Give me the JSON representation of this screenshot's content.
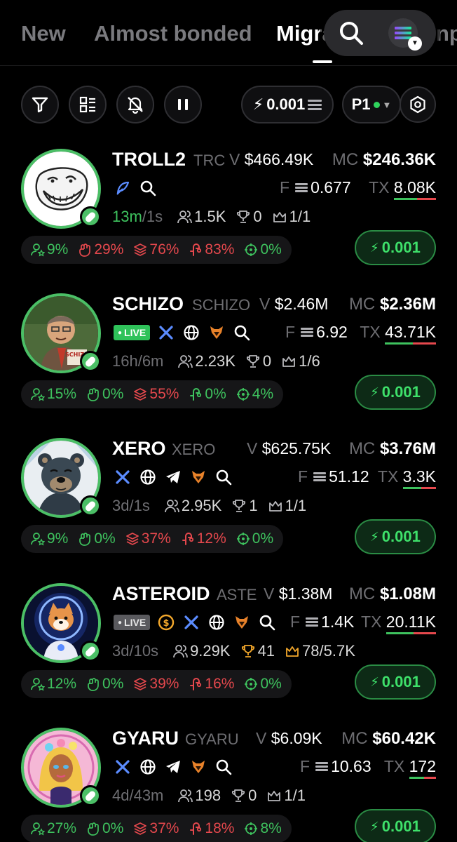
{
  "tabs": [
    {
      "label": "New",
      "active": false
    },
    {
      "label": "Almost bonded",
      "active": false
    },
    {
      "label": "Migra",
      "active": true
    },
    {
      "label": "np",
      "active": false
    }
  ],
  "toolbar": {
    "quick_buy_amount": "0.001",
    "preset_label": "P1"
  },
  "colors": {
    "accent_green": "#3ec25e",
    "danger_red": "#e5484d",
    "muted": "#6e6e72"
  },
  "tokens": [
    {
      "name": "TROLL2",
      "ticker": "TRC",
      "volume_label": "V",
      "volume": "$466.49K",
      "mc_label": "MC",
      "market_cap": "$246.36K",
      "fee_label": "F",
      "fee": "0.677",
      "tx_label": "TX",
      "tx": "8.08K",
      "age": "13m",
      "age_extra": "/1s",
      "age_highlight": true,
      "holders": "1.5K",
      "trophies": "0",
      "top_holders": "1/1",
      "socials": [
        "feather-icon",
        "search-icon"
      ],
      "live": null,
      "stats": {
        "dev": "9%",
        "snipers": "29%",
        "top10": "76%",
        "bundlers": "83%",
        "insiders": "0%"
      },
      "stat_colors": [
        "g",
        "r",
        "r",
        "r",
        "g"
      ],
      "buy_label": "0.001",
      "avatar": "troll-face"
    },
    {
      "name": "SCHIZO",
      "ticker": "SCHIZO",
      "volume_label": "V",
      "volume": "$2.46M",
      "mc_label": "MC",
      "market_cap": "$2.36M",
      "fee_label": "F",
      "fee": "6.92",
      "tx_label": "TX",
      "tx": "43.71K",
      "age": "16h/6m",
      "age_extra": "",
      "age_highlight": false,
      "holders": "2.23K",
      "trophies": "0",
      "top_holders": "1/6",
      "socials": [
        "x-icon",
        "globe-icon",
        "fox-icon",
        "search-icon"
      ],
      "live": "LIVE",
      "stats": {
        "dev": "15%",
        "snipers": "0%",
        "top10": "55%",
        "bundlers": "0%",
        "insiders": "4%"
      },
      "stat_colors": [
        "g",
        "g",
        "r",
        "g",
        "g"
      ],
      "buy_label": "0.001",
      "avatar": "painted-man",
      "avatar_label": "SCHIZO"
    },
    {
      "name": "XERO",
      "ticker": "XERO",
      "volume_label": "V",
      "volume": "$625.75K",
      "mc_label": "MC",
      "market_cap": "$3.76M",
      "fee_label": "F",
      "fee": "51.12",
      "tx_label": "TX",
      "tx": "3.3K",
      "age": "3d/1s",
      "age_extra": "",
      "age_highlight": false,
      "holders": "2.95K",
      "trophies": "1",
      "top_holders": "1/1",
      "socials": [
        "x-icon",
        "globe-icon",
        "telegram-icon",
        "fox-icon",
        "search-icon"
      ],
      "live": null,
      "stats": {
        "dev": "9%",
        "snipers": "0%",
        "top10": "37%",
        "bundlers": "12%",
        "insiders": "0%"
      },
      "stat_colors": [
        "g",
        "g",
        "r",
        "r",
        "g"
      ],
      "buy_label": "0.001",
      "avatar": "bear"
    },
    {
      "name": "ASTEROID",
      "ticker": "ASTE",
      "volume_label": "V",
      "volume": "$1.38M",
      "mc_label": "MC",
      "market_cap": "$1.08M",
      "fee_label": "F",
      "fee": "1.4K",
      "tx_label": "TX",
      "tx": "20.11K",
      "age": "3d/10s",
      "age_extra": "",
      "age_highlight": false,
      "holders": "9.29K",
      "trophies": "41",
      "top_holders": "78/5.7K",
      "trophy_highlight": true,
      "socials": [
        "coin-icon",
        "x-icon",
        "globe-icon",
        "fox-icon",
        "search-icon"
      ],
      "live": "LIVE",
      "live_off": true,
      "stats": {
        "dev": "12%",
        "snipers": "0%",
        "top10": "39%",
        "bundlers": "16%",
        "insiders": "0%"
      },
      "stat_colors": [
        "g",
        "g",
        "r",
        "r",
        "g"
      ],
      "buy_label": "0.001",
      "avatar": "shiba-astronaut"
    },
    {
      "name": "GYARU",
      "ticker": "GYARU",
      "volume_label": "V",
      "volume": "$6.09K",
      "mc_label": "MC",
      "market_cap": "$60.42K",
      "fee_label": "F",
      "fee": "10.63",
      "tx_label": "TX",
      "tx": "172",
      "age": "4d/43m",
      "age_extra": "",
      "age_highlight": false,
      "holders": "198",
      "trophies": "0",
      "top_holders": "1/1",
      "socials": [
        "x-icon",
        "globe-icon",
        "telegram-icon",
        "fox-icon",
        "search-icon"
      ],
      "live": null,
      "stats": {
        "dev": "27%",
        "snipers": "0%",
        "top10": "37%",
        "bundlers": "18%",
        "insiders": "8%"
      },
      "stat_colors": [
        "g",
        "g",
        "r",
        "r",
        "g"
      ],
      "buy_label": "0.001",
      "avatar": "gyaru-girl"
    }
  ]
}
